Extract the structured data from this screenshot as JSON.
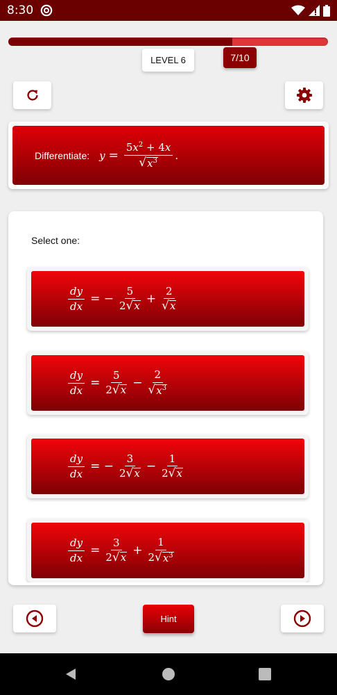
{
  "status": {
    "time": "8:30"
  },
  "progress": {
    "fraction": 0.7,
    "counter": "7/10",
    "level": "LEVEL 6"
  },
  "question": {
    "prompt": "Differentiate:"
  },
  "answers": {
    "label": "Select one:",
    "options": [
      {
        "id": "a"
      },
      {
        "id": "b"
      },
      {
        "id": "c"
      },
      {
        "id": "d"
      }
    ]
  },
  "buttons": {
    "hint": "Hint"
  },
  "icons": {
    "refresh": "refresh-icon",
    "settings": "gear-icon",
    "prev": "prev-circle-icon",
    "next": "next-circle-icon"
  },
  "colors": {
    "accent": "#8b0000",
    "bright": "#e00006"
  }
}
